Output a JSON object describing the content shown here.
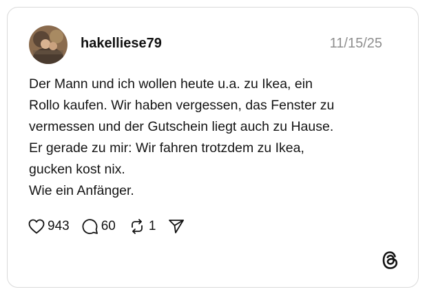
{
  "post": {
    "username": "hakelliese79",
    "timestamp": "11/15/25",
    "text_lines": [
      "Der Mann und ich wollen heute u.a. zu Ikea, ein",
      "Rollo kaufen. Wir haben vergessen, das Fenster zu",
      "vermessen und der Gutschein liegt auch zu Hause.",
      "Er gerade zu mir: Wir fahren trotzdem zu Ikea,",
      "gucken kost nix.",
      "Wie ein Anfänger."
    ]
  },
  "actions": {
    "likes": "943",
    "replies": "60",
    "reposts": "1"
  },
  "icons": {
    "like": "heart-icon",
    "reply": "comment-bubble-icon",
    "repost": "repost-icon",
    "share": "send-icon",
    "brand": "threads-logo-icon"
  }
}
